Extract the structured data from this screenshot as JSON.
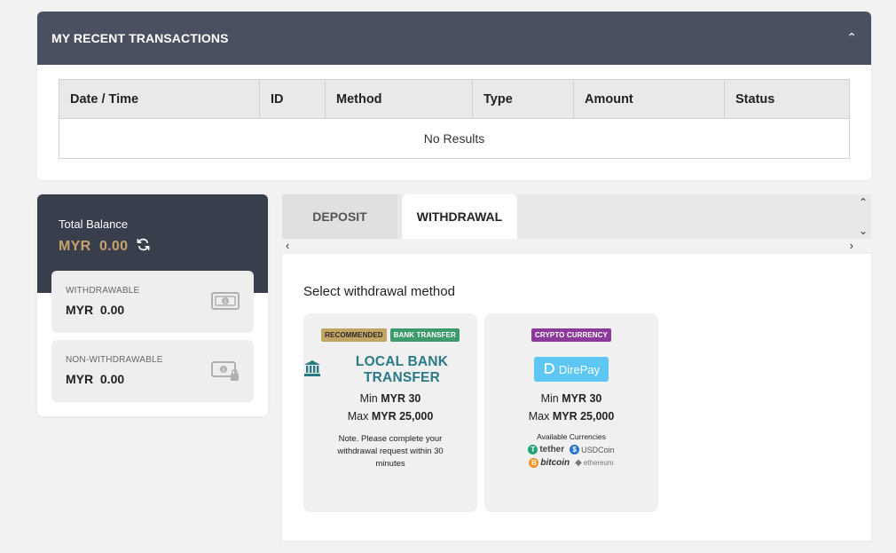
{
  "transactions": {
    "title": "MY RECENT TRANSACTIONS",
    "collapse_icon": "chevron-up-icon",
    "columns": [
      "Date / Time",
      "ID",
      "Method",
      "Type",
      "Amount",
      "Status"
    ],
    "empty_text": "No Results"
  },
  "balance": {
    "total_label": "Total Balance",
    "total_value": "MYR  0.00",
    "withdrawable_label": "WITHDRAWABLE",
    "withdrawable_value": "MYR  0.00",
    "non_withdrawable_label": "NON-WITHDRAWABLE",
    "non_withdrawable_value": "MYR  0.00",
    "accent_color": "#c7a36b"
  },
  "tabs": {
    "deposit_label": "DEPOSIT",
    "withdrawal_label": "WITHDRAWAL",
    "active": "WITHDRAWAL"
  },
  "withdrawal": {
    "section_title": "Select withdrawal method",
    "methods": [
      {
        "badges": [
          "RECOMMENDED",
          "BANK TRANSFER"
        ],
        "logo_text": "LOCAL BANK TRANSFER",
        "min_label": "Min",
        "min_value": "MYR 30",
        "max_label": "Max",
        "max_value": "MYR 25,000",
        "note": "Note. Please complete your withdrawal request within 30 minutes"
      },
      {
        "badges": [
          "CRYPTO CURRENCY"
        ],
        "logo_text": "DirePay",
        "min_label": "Min",
        "min_value": "MYR 30",
        "max_label": "Max",
        "max_value": "MYR 25,000",
        "available_label": "Available Currencies",
        "currencies": [
          "tether",
          "USDCoin",
          "bitcoin",
          "ethereum"
        ]
      }
    ]
  }
}
